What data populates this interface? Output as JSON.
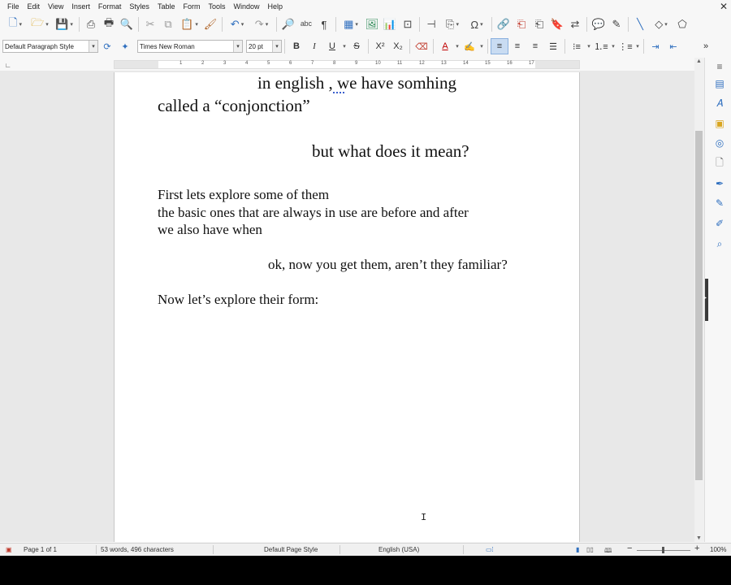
{
  "menu": [
    "File",
    "Edit",
    "View",
    "Insert",
    "Format",
    "Styles",
    "Table",
    "Form",
    "Tools",
    "Window",
    "Help"
  ],
  "formatting": {
    "paragraph_style": "Default Paragraph Style",
    "font_name": "Times New Roman",
    "font_size": "20 pt"
  },
  "document": {
    "lines": [
      "in english , we have somhing",
      "called a “conjonction”",
      "but what does it mean?",
      "First lets explore some of them",
      "the basic ones that are always in use are before and after",
      "we also have when",
      "ok, now you get them, aren’t they familiar?",
      "Now let’s explore their form:"
    ]
  },
  "ruler": {
    "numbers": [
      "1",
      "2",
      "3",
      "4",
      "5",
      "6",
      "7",
      "8",
      "9",
      "10",
      "11",
      "12",
      "13",
      "14",
      "15",
      "16",
      "17"
    ]
  },
  "status": {
    "page": "Page 1 of 1",
    "words": "53 words, 496 characters",
    "page_style": "Default Page Style",
    "language": "English (USA)",
    "zoom": "100%"
  }
}
